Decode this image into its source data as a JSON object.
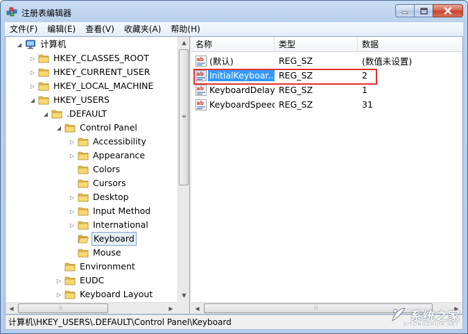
{
  "window": {
    "title": "注册表编辑器"
  },
  "menu": [
    "文件(F)",
    "编辑(E)",
    "查看(V)",
    "收藏夹(A)",
    "帮助(H)"
  ],
  "tree": [
    {
      "label": "计算机",
      "depth": 0,
      "expander": "open",
      "icon": "computer-icon"
    },
    {
      "label": "HKEY_CLASSES_ROOT",
      "depth": 1,
      "expander": "closed",
      "icon": "folder-icon"
    },
    {
      "label": "HKEY_CURRENT_USER",
      "depth": 1,
      "expander": "closed",
      "icon": "folder-icon"
    },
    {
      "label": "HKEY_LOCAL_MACHINE",
      "depth": 1,
      "expander": "closed",
      "icon": "folder-icon"
    },
    {
      "label": "HKEY_USERS",
      "depth": 1,
      "expander": "open",
      "icon": "folder-icon"
    },
    {
      "label": ".DEFAULT",
      "depth": 2,
      "expander": "open",
      "icon": "folder-icon"
    },
    {
      "label": "Control Panel",
      "depth": 3,
      "expander": "open",
      "icon": "folder-icon"
    },
    {
      "label": "Accessibility",
      "depth": 4,
      "expander": "closed",
      "icon": "folder-icon"
    },
    {
      "label": "Appearance",
      "depth": 4,
      "expander": "closed",
      "icon": "folder-icon"
    },
    {
      "label": "Colors",
      "depth": 4,
      "expander": "none",
      "icon": "folder-icon"
    },
    {
      "label": "Cursors",
      "depth": 4,
      "expander": "none",
      "icon": "folder-icon"
    },
    {
      "label": "Desktop",
      "depth": 4,
      "expander": "closed",
      "icon": "folder-icon"
    },
    {
      "label": "Input Method",
      "depth": 4,
      "expander": "closed",
      "icon": "folder-icon"
    },
    {
      "label": "International",
      "depth": 4,
      "expander": "closed",
      "icon": "folder-icon"
    },
    {
      "label": "Keyboard",
      "depth": 4,
      "expander": "none",
      "icon": "folder-open-icon",
      "selected": true
    },
    {
      "label": "Mouse",
      "depth": 4,
      "expander": "none",
      "icon": "folder-icon"
    },
    {
      "label": "Environment",
      "depth": 3,
      "expander": "none",
      "icon": "folder-icon"
    },
    {
      "label": "EUDC",
      "depth": 3,
      "expander": "closed",
      "icon": "folder-icon"
    },
    {
      "label": "Keyboard Layout",
      "depth": 3,
      "expander": "closed",
      "icon": "folder-icon"
    }
  ],
  "list": {
    "columns": [
      "名称",
      "类型",
      "数据"
    ],
    "rows": [
      {
        "name": "(默认)",
        "type": "REG_SZ",
        "data": "(数值未设置)",
        "icon": "reg-string-icon"
      },
      {
        "name": "InitialKeyboar...",
        "type": "REG_SZ",
        "data": "2",
        "icon": "reg-string-icon",
        "selected": true,
        "highlighted": true
      },
      {
        "name": "KeyboardDelay",
        "type": "REG_SZ",
        "data": "1",
        "icon": "reg-string-icon"
      },
      {
        "name": "KeyboardSpeed",
        "type": "REG_SZ",
        "data": "31",
        "icon": "reg-string-icon"
      }
    ]
  },
  "status": {
    "path": "计算机\\HKEY_USERS\\.DEFAULT\\Control Panel\\Keyboard"
  },
  "watermark": {
    "text": "系统之家",
    "sub": "XITONGZHIJIA.NET"
  },
  "colors": {
    "selection": "#3399ff",
    "highlight_box": "#e0302b",
    "folder": "#e8c048"
  }
}
